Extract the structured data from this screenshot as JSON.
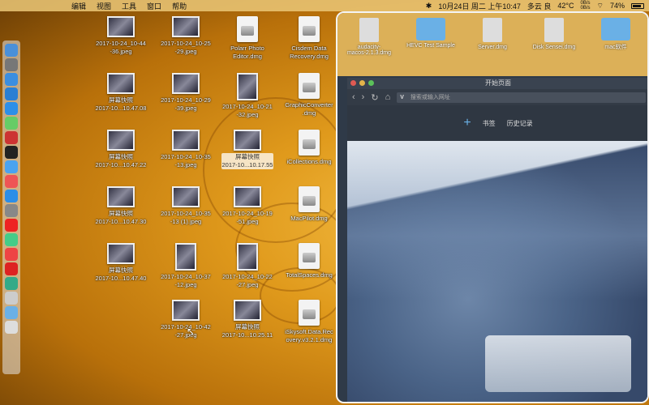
{
  "menubar": {
    "items": [
      "编辑",
      "视图",
      "工具",
      "窗口",
      "帮助"
    ],
    "datetime": "10月24日 周二 上午10:47",
    "weather": "多云 良",
    "temp": "42°C",
    "net_up": "0B/s",
    "net_down": "0B/s",
    "battery": "74%"
  },
  "dock": {
    "icons": [
      "finder-icon",
      "launchpad-icon",
      "safari-icon",
      "contacts-icon",
      "migration-icon",
      "android-icon",
      "app-icon",
      "terminal-icon",
      "siri-icon",
      "music-icon",
      "appstore-icon",
      "settings-icon",
      "yandex-icon",
      "chrome-icon",
      "weibo-icon",
      "vivaldi-icon",
      "app2-icon",
      "app3-icon",
      "folder-icon",
      "trash-icon"
    ]
  },
  "desktop": {
    "items": [
      {
        "label": "2017-10-24_10-44\n-36.jpeg",
        "kind": "thumb"
      },
      {
        "label": "2017-10-24_10-25\n-29.jpeg",
        "kind": "thumb"
      },
      {
        "label": "Polarr Photo\nEditor.dmg",
        "kind": "dmg"
      },
      {
        "label": "Cisdem Data\nRecovery.dmg",
        "kind": "dmg"
      },
      {
        "label": "屏幕快照\n2017-10...10.47.08",
        "kind": "thumb"
      },
      {
        "label": "2017-10-24_10-29\n-39.jpeg",
        "kind": "thumb"
      },
      {
        "label": "2017-10-24_10-21\n-32.jpeg",
        "kind": "thumb-tall"
      },
      {
        "label": "GraphicConverter\n.dmg",
        "kind": "dmg"
      },
      {
        "label": "屏幕快照\n2017-10...10.47.22",
        "kind": "thumb"
      },
      {
        "label": "2017-10-24_10-35\n-13.jpeg",
        "kind": "thumb"
      },
      {
        "label": "屏幕快照\n2017-10...10.17.55",
        "kind": "thumb",
        "selected": true
      },
      {
        "label": "iCollections.dmg",
        "kind": "dmg"
      },
      {
        "label": "屏幕快照\n2017-10...10.47.30",
        "kind": "thumb"
      },
      {
        "label": "2017-10-24_10-35\n-13 (1).jpeg",
        "kind": "thumb"
      },
      {
        "label": "2017-10-24_10-19\n-51.jpeg",
        "kind": "thumb"
      },
      {
        "label": "MacPilot.dmg",
        "kind": "dmg"
      },
      {
        "label": "屏幕快照\n2017-10...10.47.40",
        "kind": "thumb"
      },
      {
        "label": "2017-10-24_10-37\n-12.jpeg",
        "kind": "thumb-tall"
      },
      {
        "label": "2017-10-24_10-22\n-27.jpeg",
        "kind": "thumb-tall"
      },
      {
        "label": "TotalSpaces.dmg",
        "kind": "dmg"
      },
      {
        "label": "2017-10-24_10-42\n-27.jpeg",
        "kind": "thumb"
      },
      {
        "label": "屏幕快照\n2017-10...10.25.11",
        "kind": "thumb"
      },
      {
        "label": "iSkysoft.Data.Rec\novery.v3.2.1.dmg",
        "kind": "dmg"
      }
    ]
  },
  "window_desktop": {
    "items": [
      {
        "label": "audacity-\nmacos-2.1.3.dmg",
        "kind": "dmg"
      },
      {
        "label": "HEVC Test Sample",
        "kind": "folder"
      },
      {
        "label": "Server.dmg",
        "kind": "dmg"
      },
      {
        "label": "Disk Sensei.dmg",
        "kind": "dmg"
      },
      {
        "label": "mac软件",
        "kind": "folder"
      }
    ]
  },
  "browser": {
    "title": "开始页面",
    "address_placeholder": "搜索或输入网址",
    "bookmarks_label": "书签",
    "history_label": "历史记录"
  }
}
